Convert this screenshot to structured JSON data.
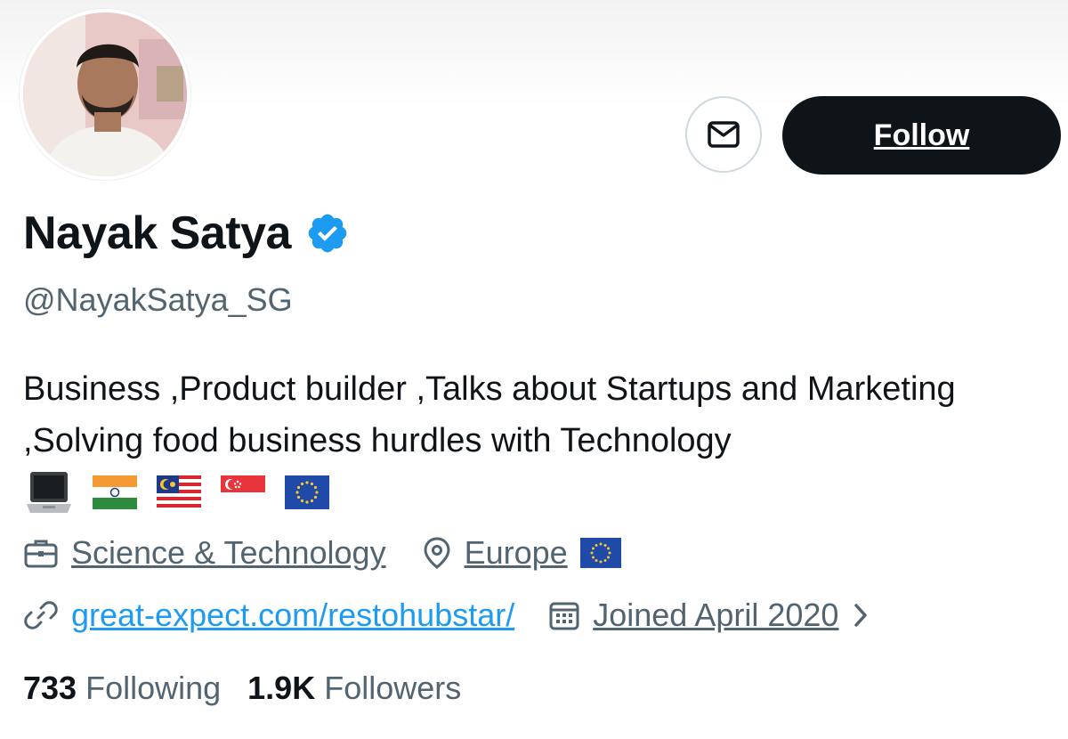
{
  "profile": {
    "avatar_alt": "profile photo",
    "name": "Nayak Satya",
    "handle": "@NayakSatya_SG",
    "bio": "Business ,Product builder ,Talks about Startups and Marketing ,Solving food business hurdles with Technology",
    "bio_emojis": [
      "laptop",
      "flag-india",
      "flag-malaysia",
      "flag-singapore",
      "flag-eu"
    ],
    "verified": true
  },
  "actions": {
    "message_icon": "envelope-icon",
    "follow_label": "Follow"
  },
  "meta": {
    "category": "Science & Technology",
    "location": "Europe",
    "location_flag": "flag-eu",
    "website": "great-expect.com/restohubstar/",
    "joined": "Joined April 2020"
  },
  "stats": {
    "following_count": "733",
    "following_label": "Following",
    "followers_count": "1.9K",
    "followers_label": "Followers"
  },
  "colors": {
    "text": "#0f1419",
    "secondary": "#536471",
    "link": "#1d9bf0",
    "button": "#0f1419"
  }
}
